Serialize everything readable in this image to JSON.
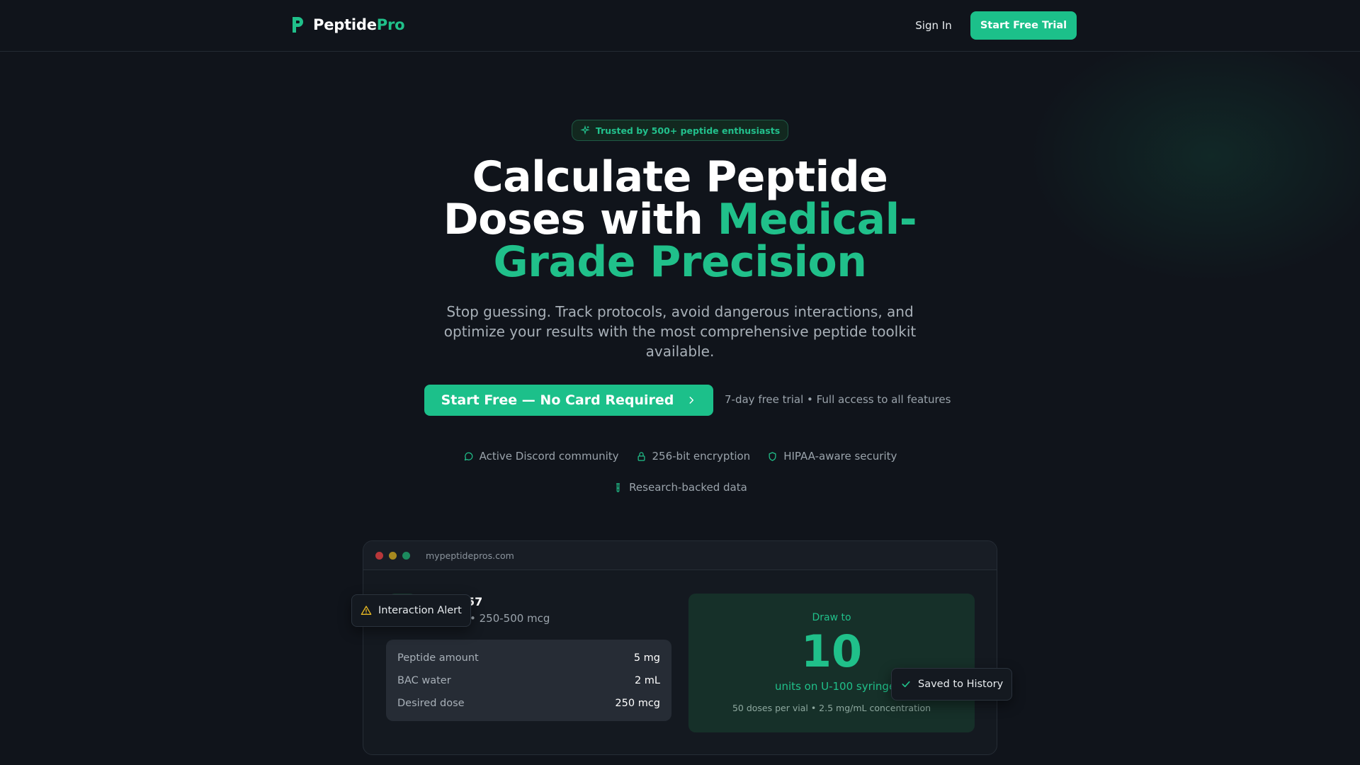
{
  "nav": {
    "logo_main": "Peptide",
    "logo_accent": "Pro",
    "signin_label": "Sign In",
    "trial_label": "Start Free Trial"
  },
  "hero": {
    "badge_text": "Trusted by 500+ peptide enthusiasts",
    "title_line1": "Calculate Peptide",
    "title_line2_plain": "Doses with ",
    "title_line2_green": "Medical-",
    "title_line3_green": "Grade Precision",
    "subtitle": "Stop guessing. Track protocols, avoid dangerous interactions, and optimize your results with the most comprehensive peptide toolkit available.",
    "cta_label": "Start Free — No Card Required",
    "cta_note": "7-day free trial • Full access to all features"
  },
  "features": [
    {
      "label": "Active Discord community",
      "icon": "chat-bubble-icon"
    },
    {
      "label": "256-bit encryption",
      "icon": "lock-icon"
    },
    {
      "label": "HIPAA-aware security",
      "icon": "shield-icon"
    },
    {
      "label": "Research-backed data",
      "icon": "test-tube-icon"
    }
  ],
  "mockup": {
    "url": "mypeptidepros.com",
    "peptide_name_fragment": "57",
    "peptide_range_fragment": "• 250-500 mcg",
    "inputs": [
      {
        "label": "Peptide amount",
        "value": "5 mg"
      },
      {
        "label": "BAC water",
        "value": "2 mL"
      },
      {
        "label": "Desired dose",
        "value": "250 mcg"
      }
    ],
    "result": {
      "draw_to": "Draw to",
      "units_value": "10",
      "units_label": "units on U-100 syringe",
      "meta": "50 doses per vial • 2.5 mg/mL concentration"
    },
    "alert_toast": "Interaction Alert",
    "saved_toast": "Saved to History"
  },
  "colors": {
    "accent": "#1cc08a",
    "background": "#10141b",
    "alert": "#e8b923",
    "dot_red": "#b8373a",
    "dot_yellow": "#a7891f",
    "dot_green": "#1c8a5e"
  }
}
